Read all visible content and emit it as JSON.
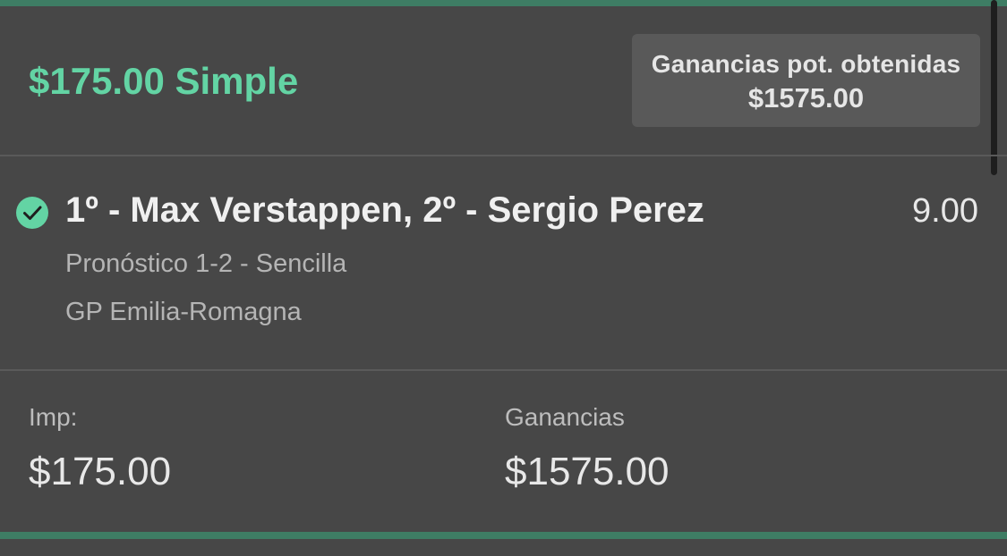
{
  "header": {
    "bet_summary": "$175.00 Simple",
    "payout_title": "Ganancias pot. obtenidas",
    "payout_value": "$1575.00"
  },
  "selection": {
    "status_icon": "check-circle-icon",
    "name": "1º - Max Verstappen, 2º - Sergio Perez",
    "odds": "9.00",
    "market": "Pronóstico 1-2 - Sencilla",
    "event": "GP Emilia-Romagna"
  },
  "footer": {
    "stake_label": "Imp:",
    "stake_value": "$175.00",
    "winnings_label": "Ganancias",
    "winnings_value": "$1575.00"
  },
  "colors": {
    "accent": "#63d4a4",
    "background": "#474747",
    "panel": "#595959",
    "border": "#3e7d64"
  }
}
